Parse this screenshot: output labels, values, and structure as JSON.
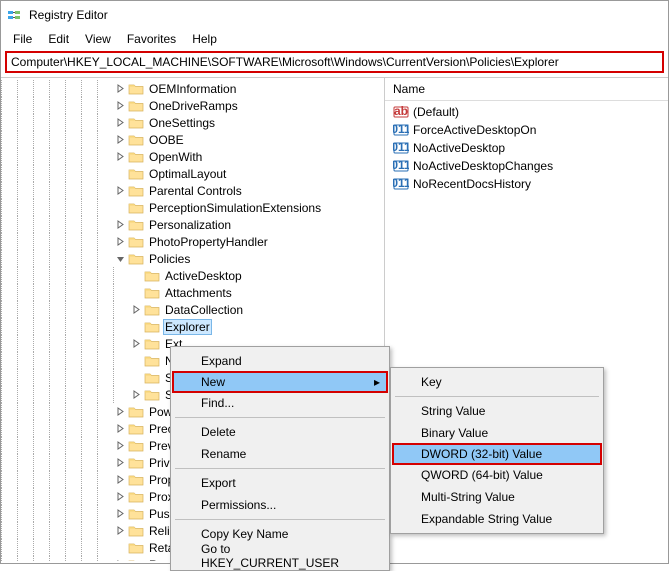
{
  "window": {
    "title": "Registry Editor"
  },
  "menubar": [
    "File",
    "Edit",
    "View",
    "Favorites",
    "Help"
  ],
  "address": "Computer\\HKEY_LOCAL_MACHINE\\SOFTWARE\\Microsoft\\Windows\\CurrentVersion\\Policies\\Explorer",
  "tree": [
    {
      "depth": 7,
      "exp": "closed",
      "label": "OEMInformation"
    },
    {
      "depth": 7,
      "exp": "closed",
      "label": "OneDriveRamps"
    },
    {
      "depth": 7,
      "exp": "closed",
      "label": "OneSettings"
    },
    {
      "depth": 7,
      "exp": "closed",
      "label": "OOBE"
    },
    {
      "depth": 7,
      "exp": "closed",
      "label": "OpenWith"
    },
    {
      "depth": 7,
      "exp": "none",
      "label": "OptimalLayout"
    },
    {
      "depth": 7,
      "exp": "closed",
      "label": "Parental Controls"
    },
    {
      "depth": 7,
      "exp": "none",
      "label": "PerceptionSimulationExtensions"
    },
    {
      "depth": 7,
      "exp": "closed",
      "label": "Personalization"
    },
    {
      "depth": 7,
      "exp": "closed",
      "label": "PhotoPropertyHandler"
    },
    {
      "depth": 7,
      "exp": "open",
      "label": "Policies"
    },
    {
      "depth": 8,
      "exp": "none",
      "label": "ActiveDesktop"
    },
    {
      "depth": 8,
      "exp": "none",
      "label": "Attachments"
    },
    {
      "depth": 8,
      "exp": "closed",
      "label": "DataCollection"
    },
    {
      "depth": 8,
      "exp": "none",
      "label": "Explorer",
      "selected": true
    },
    {
      "depth": 8,
      "exp": "closed",
      "label": "Ext"
    },
    {
      "depth": 8,
      "exp": "none",
      "label": "Nc"
    },
    {
      "depth": 8,
      "exp": "none",
      "label": "Se"
    },
    {
      "depth": 8,
      "exp": "closed",
      "label": "Sys"
    },
    {
      "depth": 7,
      "exp": "closed",
      "label": "Powe"
    },
    {
      "depth": 7,
      "exp": "closed",
      "label": "Precis"
    },
    {
      "depth": 7,
      "exp": "closed",
      "label": "Previe"
    },
    {
      "depth": 7,
      "exp": "closed",
      "label": "Privac"
    },
    {
      "depth": 7,
      "exp": "closed",
      "label": "Prope"
    },
    {
      "depth": 7,
      "exp": "closed",
      "label": "Proxin"
    },
    {
      "depth": 7,
      "exp": "closed",
      "label": "PushN"
    },
    {
      "depth": 7,
      "exp": "closed",
      "label": "Reliab"
    },
    {
      "depth": 7,
      "exp": "none",
      "label": "RetailDemo"
    },
    {
      "depth": 7,
      "exp": "closed",
      "label": "Run"
    }
  ],
  "list": {
    "header": "Name",
    "rows": [
      {
        "icon": "string",
        "label": "(Default)"
      },
      {
        "icon": "dword",
        "label": "ForceActiveDesktopOn"
      },
      {
        "icon": "dword",
        "label": "NoActiveDesktop"
      },
      {
        "icon": "dword",
        "label": "NoActiveDesktopChanges"
      },
      {
        "icon": "dword",
        "label": "NoRecentDocsHistory"
      }
    ]
  },
  "ctx1": {
    "items": [
      {
        "label": "Expand",
        "type": "item"
      },
      {
        "label": "New",
        "type": "item",
        "submenu": true,
        "highlight": true
      },
      {
        "label": "Find...",
        "type": "item"
      },
      {
        "type": "sep"
      },
      {
        "label": "Delete",
        "type": "item"
      },
      {
        "label": "Rename",
        "type": "item"
      },
      {
        "type": "sep"
      },
      {
        "label": "Export",
        "type": "item"
      },
      {
        "label": "Permissions...",
        "type": "item"
      },
      {
        "type": "sep"
      },
      {
        "label": "Copy Key Name",
        "type": "item"
      },
      {
        "label": "Go to HKEY_CURRENT_USER",
        "type": "item"
      }
    ]
  },
  "ctx2": {
    "items": [
      {
        "label": "Key",
        "type": "item"
      },
      {
        "type": "sep"
      },
      {
        "label": "String Value",
        "type": "item"
      },
      {
        "label": "Binary Value",
        "type": "item"
      },
      {
        "label": "DWORD (32-bit) Value",
        "type": "item",
        "highlight": true
      },
      {
        "label": "QWORD (64-bit) Value",
        "type": "item"
      },
      {
        "label": "Multi-String Value",
        "type": "item"
      },
      {
        "label": "Expandable String Value",
        "type": "item"
      }
    ]
  }
}
